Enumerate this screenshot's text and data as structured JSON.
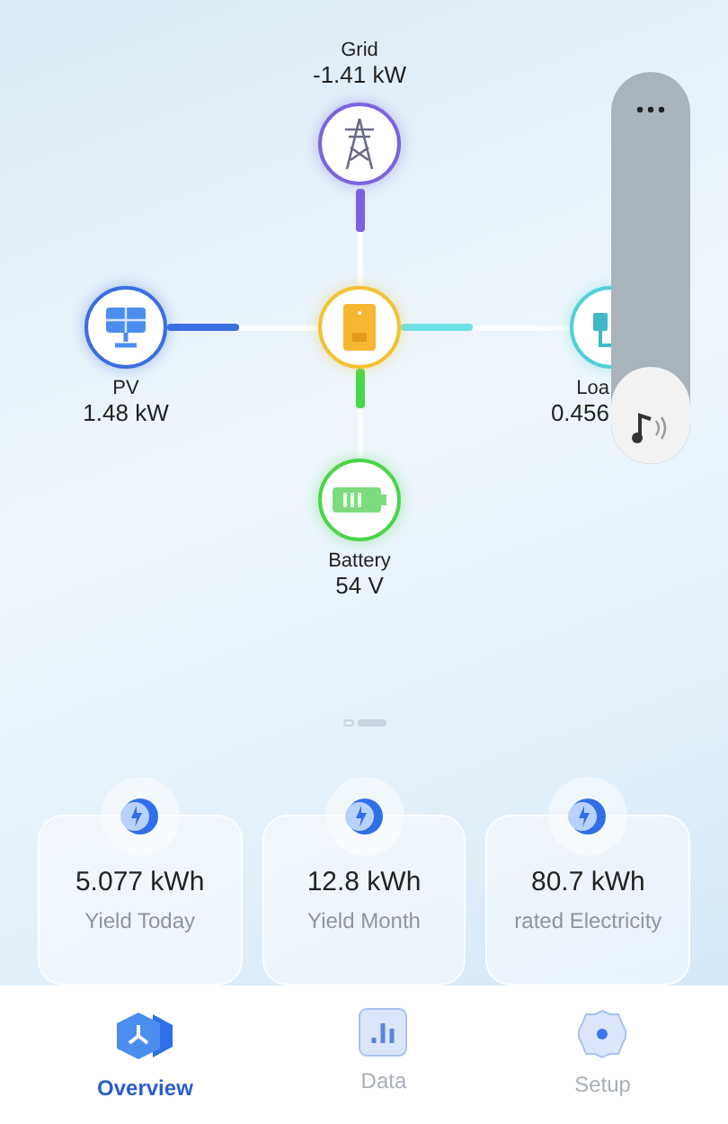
{
  "flow": {
    "nodes": [
      {
        "kind": "grid",
        "label": "Grid",
        "value": "-1.41 kW"
      },
      {
        "kind": "pv",
        "label": "PV",
        "value": "1.48 kW"
      },
      {
        "kind": "inverter"
      },
      {
        "kind": "load",
        "label": "Loa",
        "value": "0.456"
      },
      {
        "kind": "battery",
        "label": "Battery",
        "value": "54 V"
      }
    ]
  },
  "pager": [
    {
      "selected": false
    },
    {
      "selected": true
    }
  ],
  "stats": [
    {
      "value": "5.077 kWh",
      "label": "Yield Today"
    },
    {
      "value": "12.8 kWh",
      "label": "Yield Month"
    },
    {
      "value": "80.7 kWh",
      "label": "rated Electricity"
    }
  ],
  "volume_panel": {
    "level": 0.25
  },
  "nav": [
    {
      "label": "Overview",
      "kind": "overview",
      "selected": true
    },
    {
      "label": "Data",
      "kind": "data",
      "selected": false
    },
    {
      "label": "Setup",
      "kind": "setup",
      "selected": false
    }
  ]
}
